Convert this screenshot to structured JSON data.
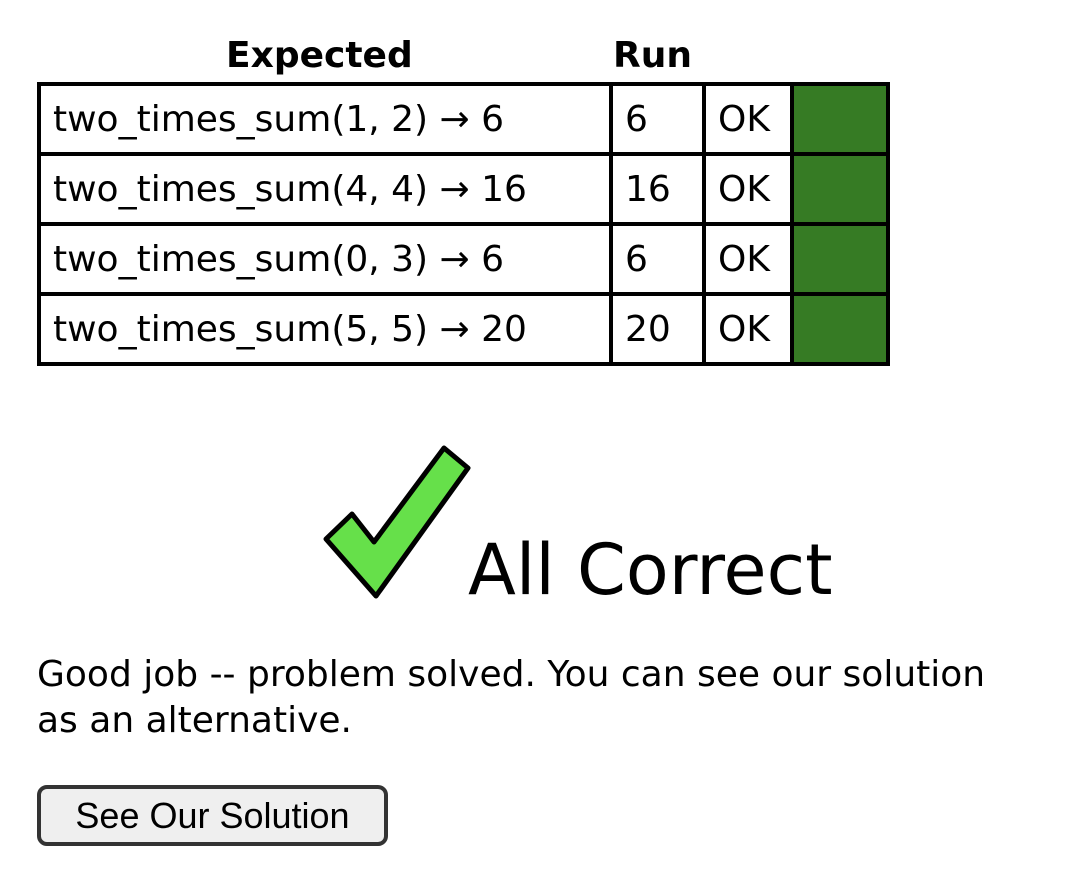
{
  "table": {
    "headers": {
      "expected": "Expected",
      "run": "Run"
    },
    "rows": [
      {
        "expected": "two_times_sum(1, 2) → 6",
        "run": "6",
        "status": "OK",
        "color": "#367b24"
      },
      {
        "expected": "two_times_sum(4, 4) → 16",
        "run": "16",
        "status": "OK",
        "color": "#367b24"
      },
      {
        "expected": "two_times_sum(0, 3) → 6",
        "run": "6",
        "status": "OK",
        "color": "#367b24"
      },
      {
        "expected": "two_times_sum(5, 5) → 20",
        "run": "20",
        "status": "OK",
        "color": "#367b24"
      }
    ]
  },
  "result": {
    "icon": "checkmark-icon",
    "icon_color": "#66e04a",
    "text": "All Correct"
  },
  "message": {
    "line1": "Good job -- problem solved. You can see our solution",
    "line2": "as an alternative."
  },
  "solution_button": {
    "label": "See Our Solution"
  }
}
